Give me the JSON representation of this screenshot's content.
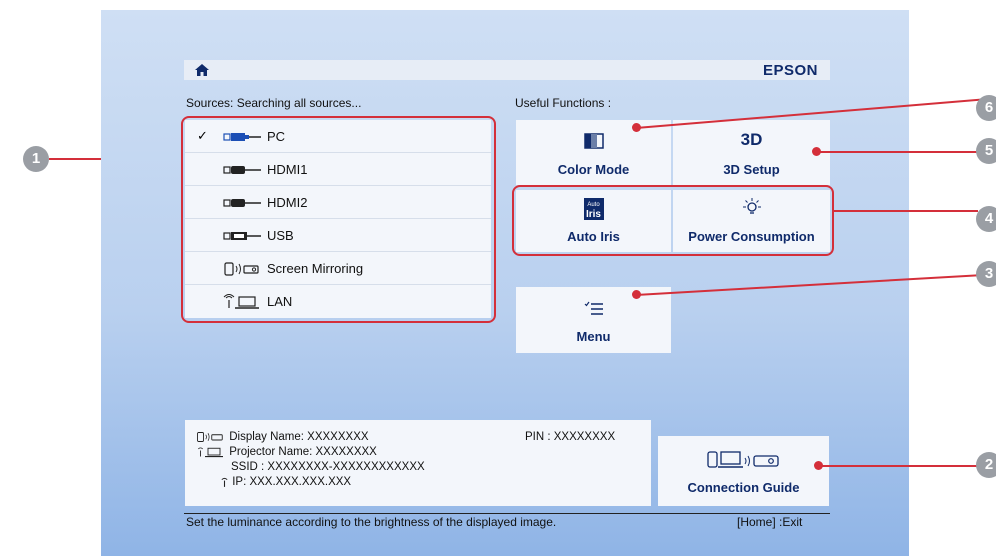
{
  "header": {
    "brand": "EPSON",
    "home_icon": "home-icon"
  },
  "sources": {
    "title": "Sources:  Searching all sources...",
    "items": [
      {
        "label": "PC",
        "icon": "pc-connector-icon",
        "checked": true
      },
      {
        "label": "HDMI1",
        "icon": "hdmi-connector-icon",
        "checked": false
      },
      {
        "label": "HDMI2",
        "icon": "hdmi-connector-icon",
        "checked": false
      },
      {
        "label": "USB",
        "icon": "usb-connector-icon",
        "checked": false
      },
      {
        "label": "Screen Mirroring",
        "icon": "screen-mirroring-icon",
        "checked": false
      },
      {
        "label": "LAN",
        "icon": "lan-icon",
        "checked": false
      }
    ],
    "check_mark": "✓"
  },
  "functions": {
    "title": "Useful Functions :",
    "color_mode": "Color Mode",
    "setup_3d": "3D Setup",
    "setup_3d_icon_text": "3D",
    "auto_iris": "Auto Iris",
    "auto_iris_icon_top": "Auto",
    "auto_iris_icon_bottom": "Iris",
    "power_consumption": "Power Consumption",
    "menu": "Menu"
  },
  "network": {
    "display_name": "Display Name:  XXXXXXXX",
    "pin": "PIN : XXXXXXXX",
    "projector_name": "Projector Name:  XXXXXXXX",
    "ssid": "SSID :  XXXXXXXX-XXXXXXXXXXXX",
    "ip": "IP:  XXX.XXX.XXX.XXX"
  },
  "connection_guide": "Connection Guide",
  "status": {
    "message": "Set the luminance according to the brightness of the displayed image.",
    "exit_hint": "[Home] :Exit"
  },
  "callouts": [
    "1",
    "2",
    "3",
    "4",
    "5",
    "6"
  ],
  "colors": {
    "accent_red": "#d42f3a",
    "brand_blue": "#0f2a6a",
    "badge_grey": "#9a9ea4"
  }
}
